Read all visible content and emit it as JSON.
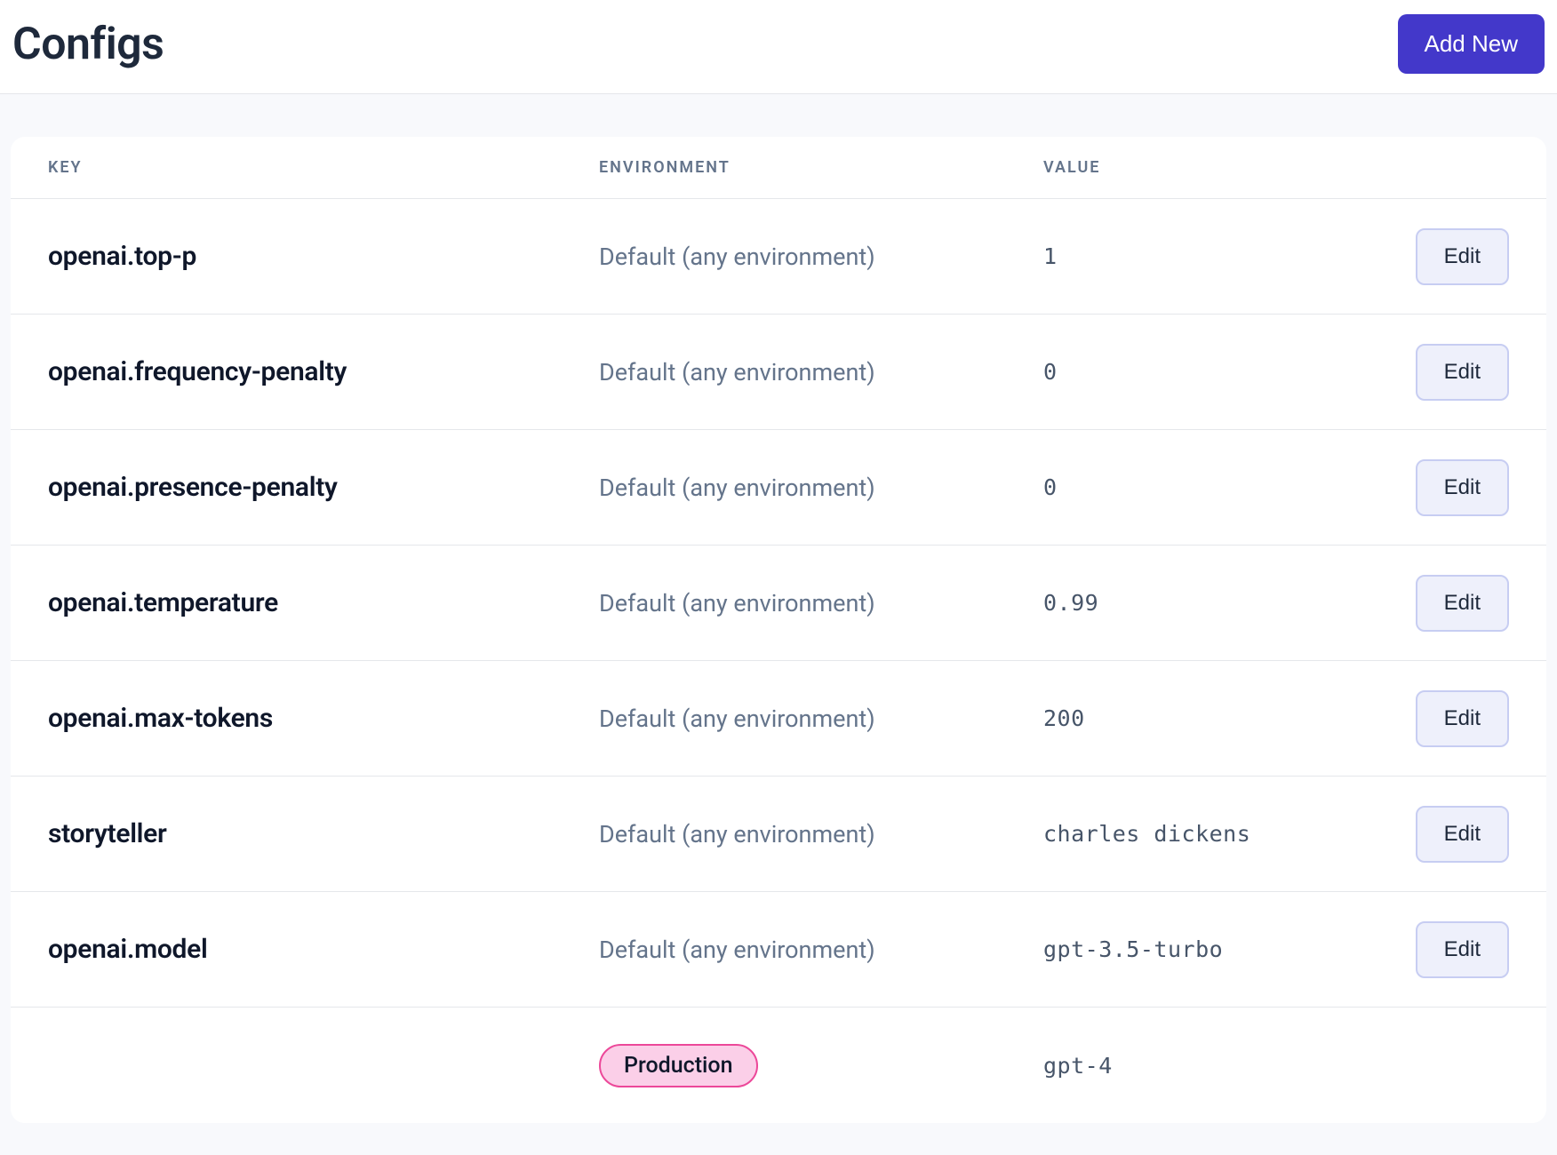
{
  "header": {
    "title": "Configs",
    "add_new_label": "Add New"
  },
  "table": {
    "columns": {
      "key": "KEY",
      "environment": "ENVIRONMENT",
      "value": "VALUE"
    },
    "edit_label": "Edit",
    "rows": [
      {
        "key": "openai.top-p",
        "envs": [
          {
            "label": "Default (any environment)",
            "value": "1",
            "badge": false,
            "editable": true
          }
        ]
      },
      {
        "key": "openai.frequency-penalty",
        "envs": [
          {
            "label": "Default (any environment)",
            "value": "0",
            "badge": false,
            "editable": true
          }
        ]
      },
      {
        "key": "openai.presence-penalty",
        "envs": [
          {
            "label": "Default (any environment)",
            "value": "0",
            "badge": false,
            "editable": true
          }
        ]
      },
      {
        "key": "openai.temperature",
        "envs": [
          {
            "label": "Default (any environment)",
            "value": "0.99",
            "badge": false,
            "editable": true
          }
        ]
      },
      {
        "key": "openai.max-tokens",
        "envs": [
          {
            "label": "Default (any environment)",
            "value": "200",
            "badge": false,
            "editable": true
          }
        ]
      },
      {
        "key": "storyteller",
        "envs": [
          {
            "label": "Default (any environment)",
            "value": "charles dickens",
            "badge": false,
            "editable": true
          }
        ]
      },
      {
        "key": "openai.model",
        "envs": [
          {
            "label": "Default (any environment)",
            "value": "gpt-3.5-turbo",
            "badge": false,
            "editable": true
          },
          {
            "label": "Production",
            "value": "gpt-4",
            "badge": true,
            "editable": false
          }
        ]
      }
    ]
  }
}
